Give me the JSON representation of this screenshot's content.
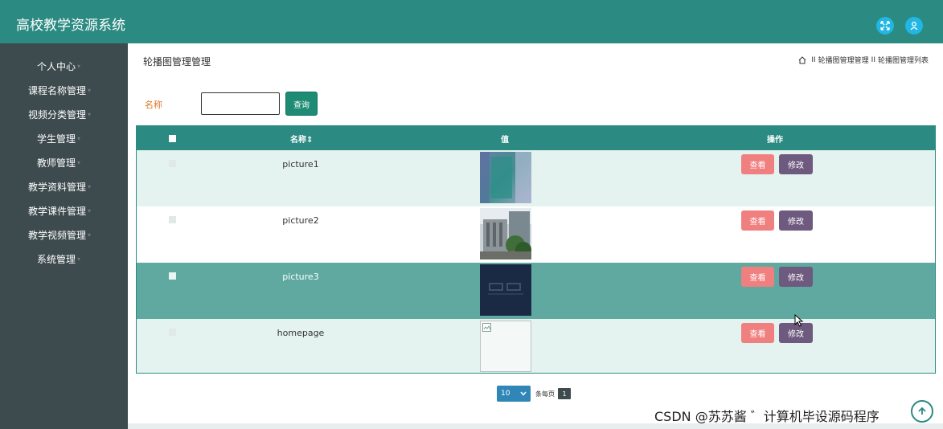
{
  "app": {
    "title": "高校教学资源系统"
  },
  "header_icons": [
    "fullscreen-icon",
    "user-icon"
  ],
  "sidebar": {
    "items": [
      {
        "label": "个人中心"
      },
      {
        "label": "课程名称管理"
      },
      {
        "label": "视频分类管理"
      },
      {
        "label": "学生管理"
      },
      {
        "label": "教师管理"
      },
      {
        "label": "教学资料管理"
      },
      {
        "label": "教学课件管理"
      },
      {
        "label": "教学视频管理"
      },
      {
        "label": "系统管理"
      }
    ]
  },
  "page": {
    "title": "轮播图管理管理",
    "breadcrumb": [
      "轮播图管理管理",
      "轮播图管理列表"
    ],
    "breadcrumb_separator": "II"
  },
  "search": {
    "label": "名称",
    "value": "",
    "button_label": "查询"
  },
  "table": {
    "columns": [
      "名称",
      "值",
      "操作"
    ],
    "sort_marker": "⇕",
    "rows": [
      {
        "name": "picture1",
        "view_label": "查看",
        "edit_label": "修改"
      },
      {
        "name": "picture2",
        "view_label": "查看",
        "edit_label": "修改"
      },
      {
        "name": "picture3",
        "view_label": "查看",
        "edit_label": "修改"
      },
      {
        "name": "homepage",
        "view_label": "查看",
        "edit_label": "修改"
      }
    ]
  },
  "pagination": {
    "page_size": "10",
    "per_page_label": "条每页",
    "current_page": "1"
  },
  "watermark": "CSDN @苏苏酱 ゛计算机毕设源码程序",
  "colors": {
    "primary": "#2b8a82",
    "sidebar": "#3d4a4e",
    "view": "#f08080",
    "edit": "#6e5a7e",
    "row_even": "#e5f3f0",
    "row_highlight": "#5fa9a1"
  }
}
